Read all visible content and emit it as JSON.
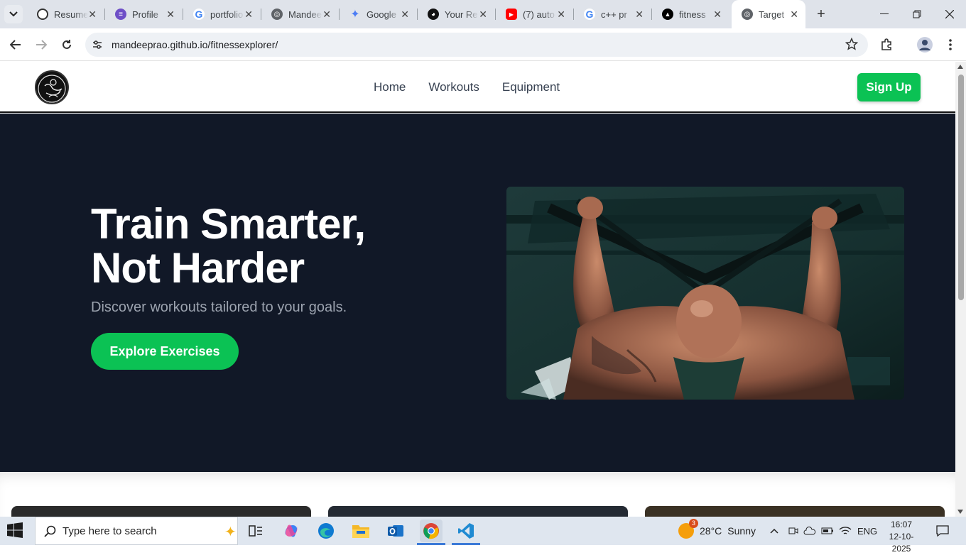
{
  "browser": {
    "tabs": [
      {
        "title": "Resume",
        "icon": "openai-icon",
        "color": "#202124"
      },
      {
        "title": "Profile",
        "icon": "profile-icon",
        "color": "#6e4fc7"
      },
      {
        "title": "portfolio",
        "icon": "google-icon",
        "color": "#4285f4"
      },
      {
        "title": "Mandeep",
        "icon": "globe-icon",
        "color": "#5f6368"
      },
      {
        "title": "Google",
        "icon": "gemini-icon",
        "color": "#4c7df5"
      },
      {
        "title": "Your Re",
        "icon": "github-icon",
        "color": "#111111"
      },
      {
        "title": "(7) auto",
        "icon": "youtube-icon",
        "color": "#ff0000"
      },
      {
        "title": "c++ pr",
        "icon": "google-icon",
        "color": "#4285f4"
      },
      {
        "title": "fitness",
        "icon": "vercel-icon",
        "color": "#000000"
      },
      {
        "title": "Target",
        "icon": "globe-icon",
        "color": "#5f6368"
      }
    ],
    "active_tab": 9,
    "url": "mandeeprao.github.io/fitnessexplorer/"
  },
  "site": {
    "nav": [
      "Home",
      "Workouts",
      "Equipment"
    ],
    "signup_label": "Sign Up",
    "hero": {
      "title_line1": "Train Smarter,",
      "title_line2": "Not Harder",
      "subtitle": "Discover workouts tailored to your goals.",
      "cta_label": "Explore Exercises"
    },
    "colors": {
      "accent": "#0bc254",
      "hero_bg": "#111827",
      "subtitle": "#9ca3af"
    }
  },
  "taskbar": {
    "search_placeholder": "Type here to search",
    "weather_temp": "28°C",
    "weather_text": "Sunny",
    "weather_badge": "3",
    "language": "ENG",
    "time": "16:07",
    "date": "12-10-2025"
  }
}
